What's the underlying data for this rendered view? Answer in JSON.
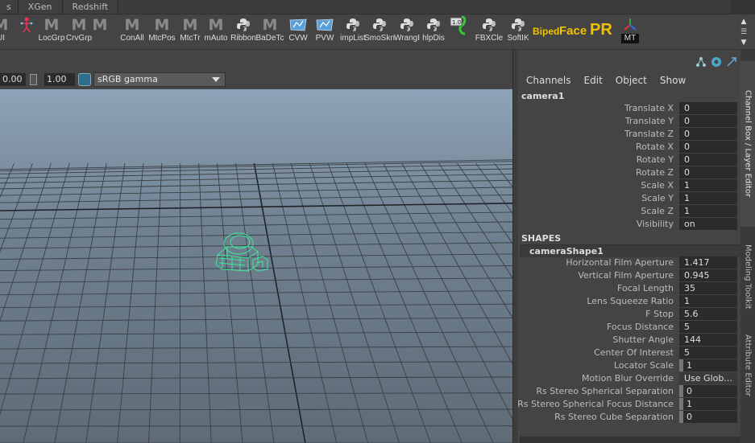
{
  "top_tabs": [
    "s",
    "XGen",
    "Redshift"
  ],
  "shelf": {
    "buttons": [
      {
        "label": "UI",
        "icon": "ui-icon"
      },
      {
        "label": "",
        "icon": "skeleton-figure-icon"
      },
      {
        "label": "LocGrp",
        "icon": "m-icon"
      },
      {
        "label": "CrvGrp",
        "icon": "m-icon"
      },
      {
        "label": "",
        "icon": "m-icon"
      },
      {
        "label": "ConAll",
        "icon": "m-icon"
      },
      {
        "label": "MtcPos",
        "icon": "m-icon"
      },
      {
        "label": "MtcTr",
        "icon": "m-icon"
      },
      {
        "label": "mAuto",
        "icon": "m-icon"
      },
      {
        "label": "Ribbon",
        "icon": "python-icon"
      },
      {
        "label": "BaDeTc",
        "icon": "m-icon"
      },
      {
        "label": "CVW",
        "icon": "cvw-icon"
      },
      {
        "label": "PVW",
        "icon": "pvw-icon"
      },
      {
        "label": "impList",
        "icon": "python-icon"
      },
      {
        "label": "SmoSkn",
        "icon": "python-icon"
      },
      {
        "label": "WrangI",
        "icon": "python-icon"
      },
      {
        "label": "hlpDis",
        "icon": "python-icon"
      },
      {
        "label": "",
        "icon": "slider-value-icon",
        "badge": "1.0"
      },
      {
        "label": "FBXCle",
        "icon": "python-icon"
      },
      {
        "label": "SoftIK",
        "icon": "python-icon"
      }
    ],
    "biped_label": "Biped",
    "face_label": "Face",
    "pr_label": "PR",
    "mt_label": "MT"
  },
  "viewport_toolbar": {
    "field1": "0.00",
    "field2": "1.00",
    "colorspace": "sRGB gamma"
  },
  "channel_box": {
    "menus": [
      "Channels",
      "Edit",
      "Object",
      "Show"
    ],
    "node": "camera1",
    "transform_attrs": [
      {
        "name": "Translate X",
        "value": "0"
      },
      {
        "name": "Translate Y",
        "value": "0"
      },
      {
        "name": "Translate Z",
        "value": "0"
      },
      {
        "name": "Rotate X",
        "value": "0"
      },
      {
        "name": "Rotate Y",
        "value": "0"
      },
      {
        "name": "Rotate Z",
        "value": "0"
      },
      {
        "name": "Scale X",
        "value": "1"
      },
      {
        "name": "Scale Y",
        "value": "1"
      },
      {
        "name": "Scale Z",
        "value": "1"
      },
      {
        "name": "Visibility",
        "value": "on"
      }
    ],
    "shapes_header": "SHAPES",
    "shape_node": "cameraShape1",
    "shape_attrs": [
      {
        "name": "Horizontal Film Aperture",
        "value": "1.417"
      },
      {
        "name": "Vertical Film Aperture",
        "value": "0.945"
      },
      {
        "name": "Focal Length",
        "value": "35"
      },
      {
        "name": "Lens Squeeze Ratio",
        "value": "1"
      },
      {
        "name": "F Stop",
        "value": "5.6"
      },
      {
        "name": "Focus Distance",
        "value": "5"
      },
      {
        "name": "Shutter Angle",
        "value": "144"
      },
      {
        "name": "Center Of Interest",
        "value": "5"
      },
      {
        "name": "Locator Scale",
        "value": "1",
        "marked": true
      },
      {
        "name": "Motion Blur Override",
        "value": "Use Glob...",
        "dropdown": true
      },
      {
        "name": "Rs Stereo Spherical Separation",
        "value": "0",
        "marked": true
      },
      {
        "name": "Rs Stereo Spherical Focus Distance",
        "value": "1",
        "marked": true
      },
      {
        "name": "Rs Stereo Cube Separation",
        "value": "0",
        "marked": true
      }
    ]
  },
  "side_tabs": [
    "Channel Box / Layer Editor",
    "Modeling Toolkit",
    "Attribute Editor"
  ],
  "colors": {
    "panel_bg": "#444444",
    "field_bg": "#2b2b2b",
    "accent_yellow": "#f2c200",
    "camera_wire": "#3fe89a",
    "grid_line": "#3a3f44"
  }
}
